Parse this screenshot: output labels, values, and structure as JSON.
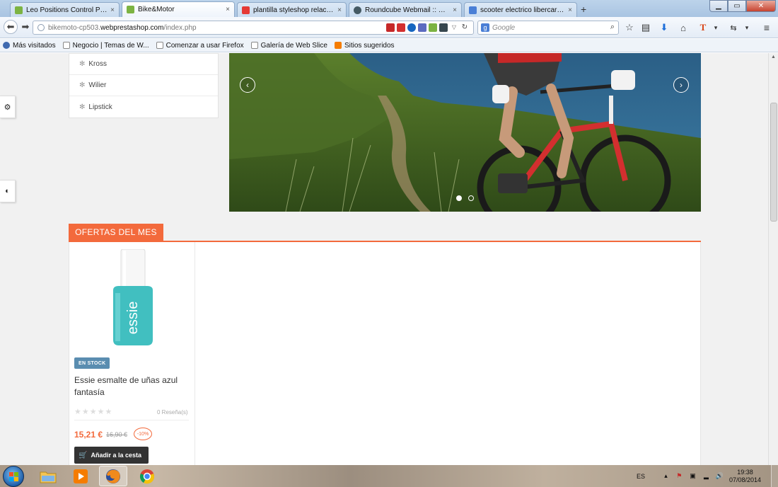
{
  "browser": {
    "tabs": [
      {
        "title": "Leo Positions Control Pane...",
        "favicon_color": "#7cb342",
        "active": false
      },
      {
        "title": "Bike&Motor",
        "favicon_color": "#7cb342",
        "active": true
      },
      {
        "title": "plantilla styleshop relacion...",
        "favicon_color": "#e53935",
        "active": false
      },
      {
        "title": "Roundcube Webmail :: Ent...",
        "favicon_color": "#455a64",
        "active": false
      },
      {
        "title": "scooter electrico libercar ur...",
        "favicon_color": "#4a7fd6",
        "active": false
      }
    ],
    "new_tab_label": "+",
    "close_tab_label": "×",
    "url_prefix": "bikemoto-cp503.",
    "url_domain": "webprestashop.com",
    "url_path": "/index.php",
    "search_engine_label": "g",
    "search_placeholder": "Google",
    "bookmarks": [
      {
        "label": "Más visitados",
        "icon": "gear-icon"
      },
      {
        "label": "Negocio | Temas de W...",
        "icon": "page-icon"
      },
      {
        "label": "Comenzar a usar Firefox",
        "icon": "page-icon"
      },
      {
        "label": "Galería de Web Slice",
        "icon": "page-icon"
      },
      {
        "label": "Sitios sugeridos",
        "icon": "bookmark-icon"
      }
    ]
  },
  "page": {
    "categories": [
      "Kross",
      "Wilier",
      "Lipstick"
    ],
    "slider": {
      "prev_label": "‹",
      "next_label": "›",
      "dots": 2,
      "active_dot": 0
    },
    "offers": {
      "title": "OFERTAS DEL MES",
      "product": {
        "brand_on_bottle": "essie",
        "stock_label": "EN STOCK",
        "name": "Essie esmalte de uñas azul fantasía",
        "rating": 0,
        "reviews_label": "0 Reseña(s)",
        "price": "15,21 €",
        "old_price": "16,90 €",
        "discount": "-10%",
        "add_to_cart_label": "Añadir a la cesta"
      }
    }
  },
  "taskbar": {
    "language": "ES",
    "time": "19:38",
    "date": "07/08/2014"
  },
  "colors": {
    "accent": "#f36a3c",
    "stock_badge": "#5a8db0",
    "cart_button": "#333333"
  }
}
